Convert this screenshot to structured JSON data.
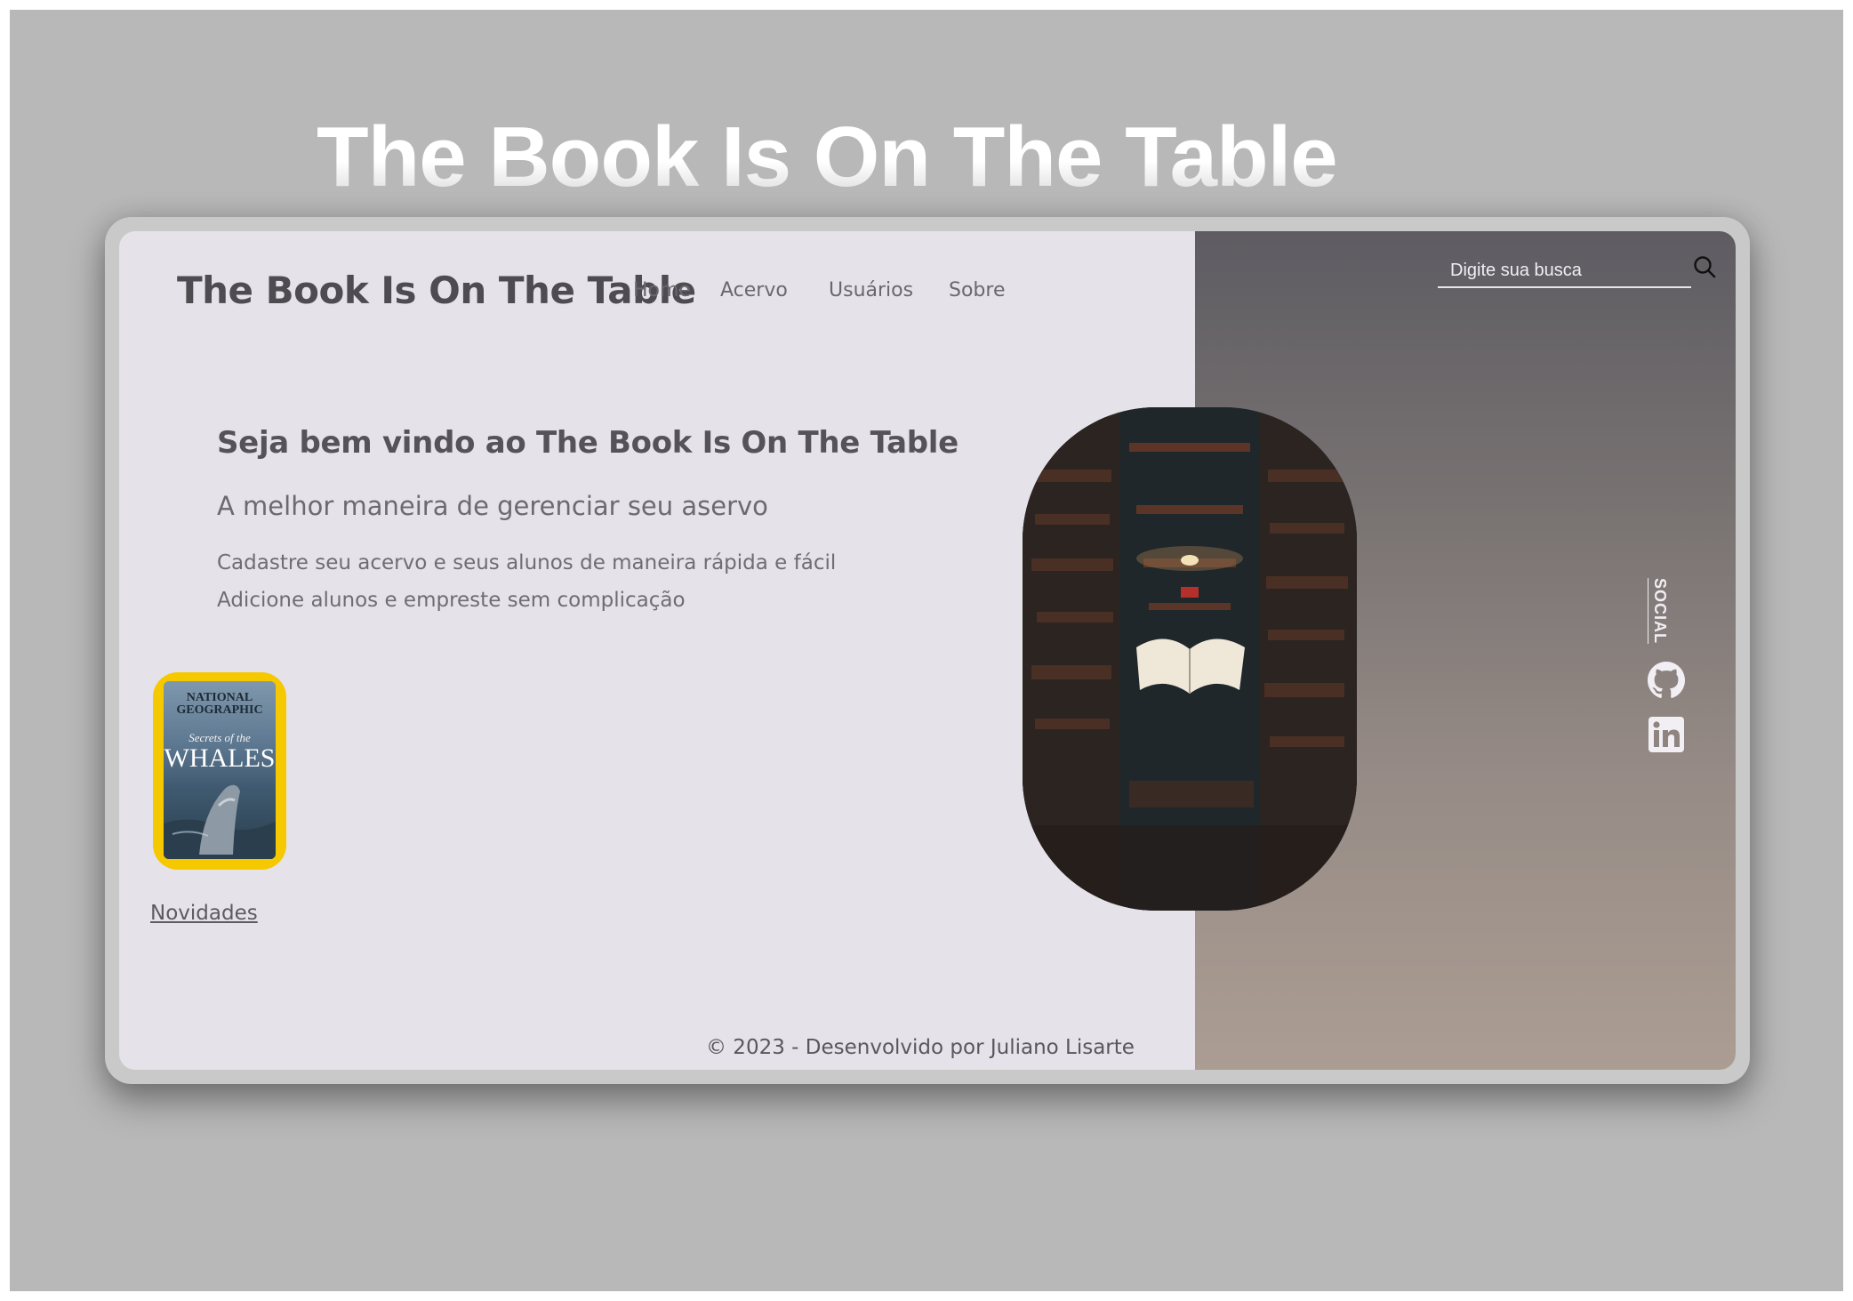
{
  "page": {
    "hero_title": "The Book Is On The Table"
  },
  "header": {
    "brand": "The Book Is On The Table",
    "nav": [
      {
        "label": "Home"
      },
      {
        "label": "Acervo"
      },
      {
        "label": "Usuários"
      },
      {
        "label": "Sobre"
      }
    ],
    "search": {
      "placeholder": "Digite sua busca",
      "value": ""
    }
  },
  "main": {
    "welcome": "Seja bem vindo ao The Book Is On The Table",
    "subtitle": "A melhor maneira de gerenciar seu aservo",
    "lines": [
      "Cadastre seu acervo e seus alunos de maneira rápida e fácil",
      "Adicione alunos e empreste sem complicação"
    ],
    "featured": {
      "magazine": "NATIONAL GEOGRAPHIC",
      "teaser": "Secrets of the",
      "headline": "WHALES",
      "link_label": "Novidades"
    }
  },
  "social": {
    "label": "SOCIAL",
    "icons": [
      "github-icon",
      "linkedin-icon"
    ]
  },
  "footer": {
    "text": "© 2023 - Desenvolvido por Juliano Lisarte"
  },
  "colors": {
    "background": "#b8b8b8",
    "screen": "#e5e2e9",
    "panel_top": "#5e5c62",
    "panel_bottom": "#ab9d92",
    "cover_border": "#f5c800"
  }
}
